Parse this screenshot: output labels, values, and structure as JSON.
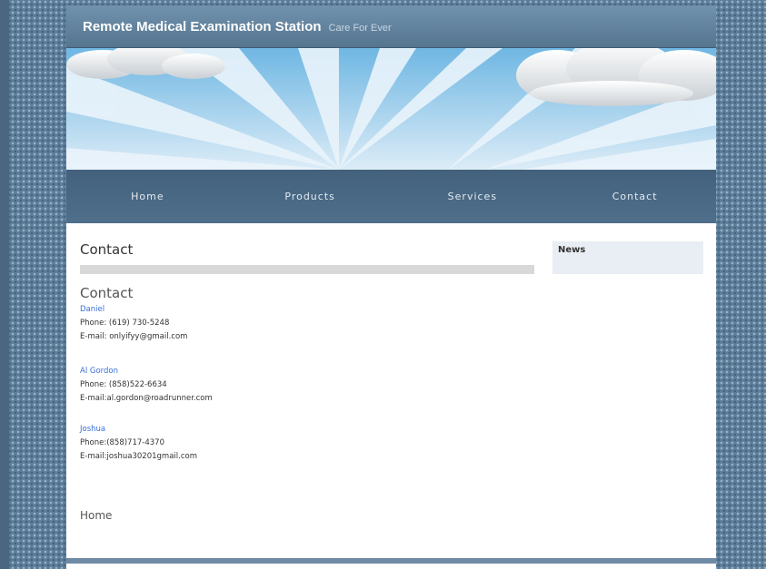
{
  "header": {
    "site_title": "Remote Medical Examination Station",
    "tagline": "Care For Ever"
  },
  "nav": {
    "items": [
      "Home",
      "Products",
      "Services",
      "Contact"
    ]
  },
  "main": {
    "title": "Contact",
    "contact_heading": "Contact",
    "people": [
      {
        "name": "Daniel",
        "phone": "Phone: (619) 730-5248",
        "email": "E-mail: onlyifyy@gmail.com"
      },
      {
        "name": "Al Gordon",
        "phone": "Phone: (858)522-6634",
        "email": "E-mail:al.gordon@roadrunner.com"
      },
      {
        "name": "Joshua",
        "phone": "Phone:(858)717-4370",
        "email": "E-mail:joshua30201gmail.com"
      }
    ],
    "home_link": "Home"
  },
  "sidebar": {
    "title": "News"
  },
  "colors": {
    "accent_link": "#3a6fd8",
    "header": "#55758f",
    "nav": "#43617c"
  }
}
